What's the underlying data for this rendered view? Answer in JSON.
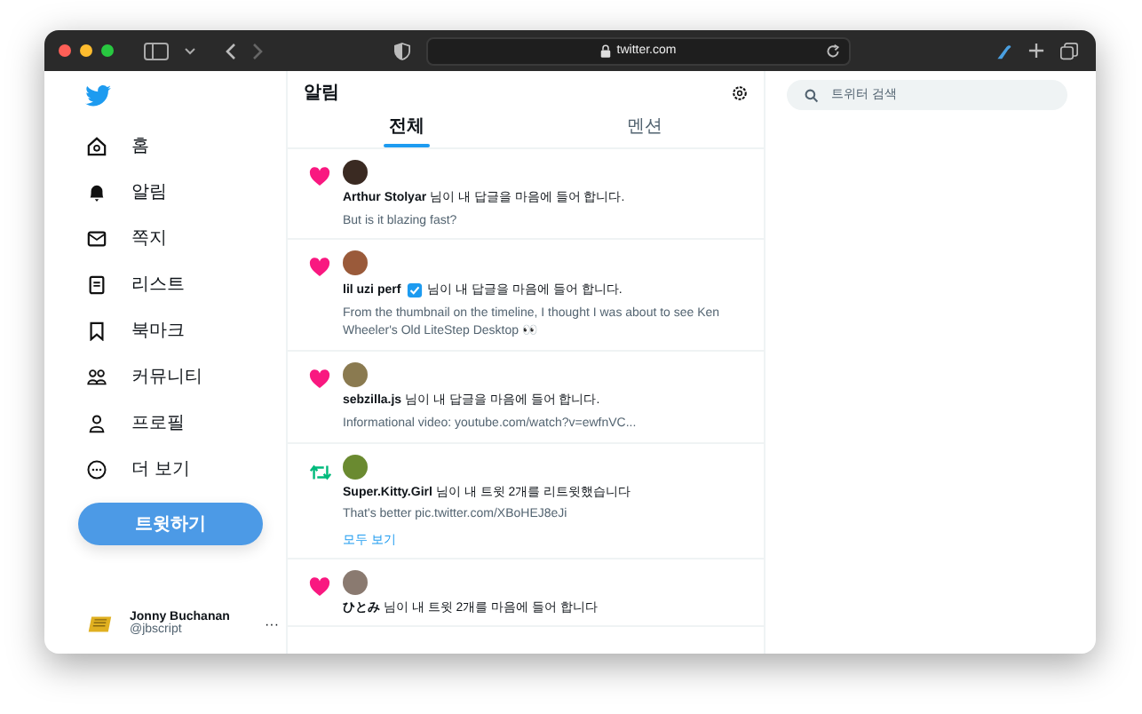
{
  "browser": {
    "url": "twitter.com"
  },
  "sidebar": {
    "items": [
      {
        "kind": "home",
        "label": "홈"
      },
      {
        "kind": "bell",
        "label": "알림"
      },
      {
        "kind": "mail",
        "label": "쪽지"
      },
      {
        "kind": "list",
        "label": "리스트"
      },
      {
        "kind": "bookmark",
        "label": "북마크"
      },
      {
        "kind": "people",
        "label": "커뮤니티"
      },
      {
        "kind": "person",
        "label": "프로필"
      },
      {
        "kind": "more",
        "label": "더 보기"
      }
    ],
    "tweet_button": "트윗하기",
    "account": {
      "name": "Jonny Buchanan",
      "handle": "@jbscript",
      "menu": "···"
    }
  },
  "main": {
    "title": "알림",
    "tabs": [
      {
        "label": "전체",
        "selected": true
      },
      {
        "label": "멘션",
        "selected": false
      }
    ],
    "notifications": [
      {
        "kind": "like",
        "text": "**Arthur Stolyar** 님이 내 답글을 마음에 들어 합니다.",
        "verified": false,
        "preview": "But is it blazing fast?"
      },
      {
        "kind": "like",
        "text": "**lil uzi perf**",
        "verified": true,
        "text_after": "님이 내 답글을 마음에 들어 합니다.",
        "preview": "From the thumbnail on the timeline, I thought I was about to see Ken Wheeler's Old LiteStep Desktop 👀"
      },
      {
        "kind": "like",
        "text": "**sebzilla.js** 님이 내 답글을 마음에 들어 합니다.",
        "verified": false,
        "preview": "Informational video: youtube.com/watch?v=ewfnVC..."
      },
      {
        "kind": "retweet",
        "text": "**Super.Kitty.Girl** 님이 내 트윗 2개를 리트윗했습니다",
        "verified": false,
        "preview": "That's better pic.twitter.com/XBoHEJ8eJi",
        "see_all": "모두 보기"
      },
      {
        "kind": "like",
        "text": "**ひとみ** 님이 내 트윗 2개를 마음에 들어 합니다",
        "verified": false
      }
    ]
  },
  "search": {
    "placeholder": "트위터 검색"
  }
}
